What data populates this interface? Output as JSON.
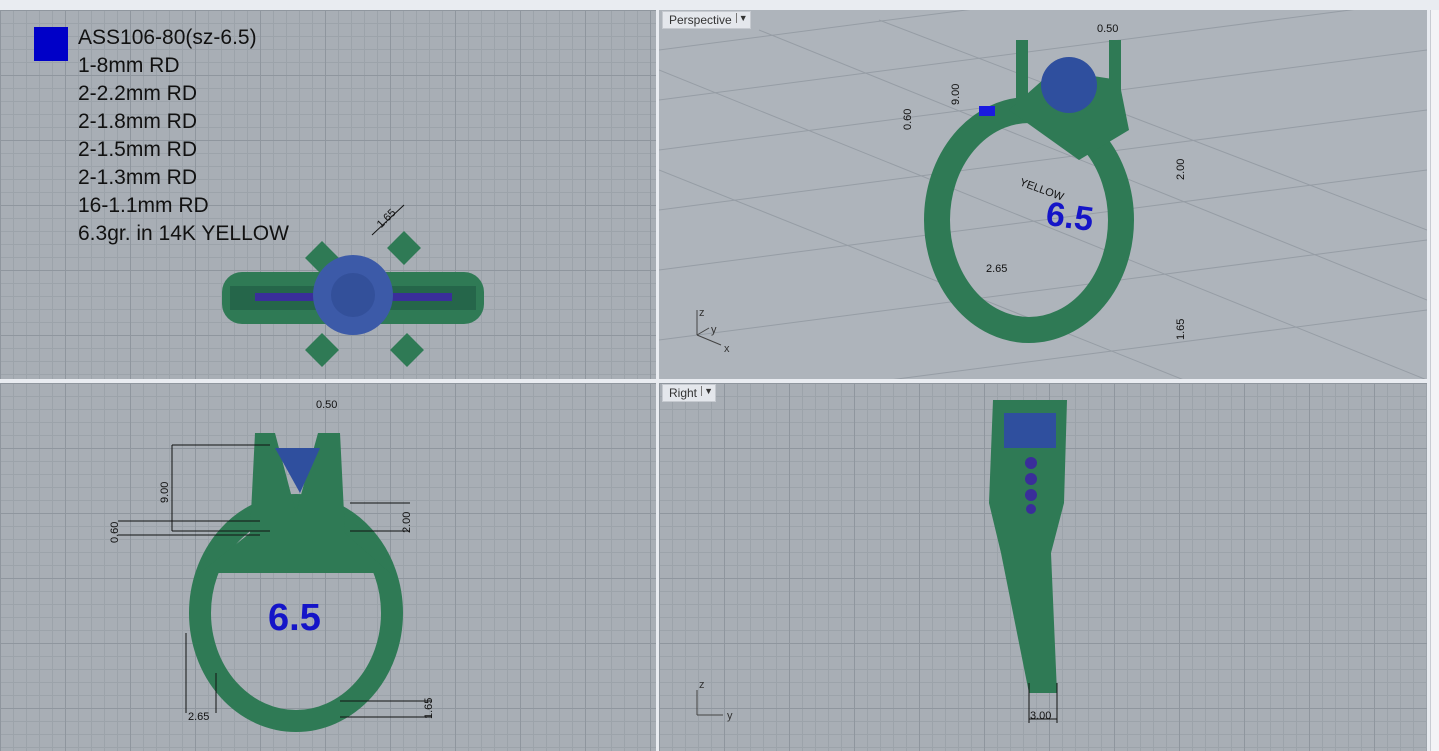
{
  "viewports": {
    "top": {
      "legend": [
        "ASS106-80(sz-6.5)",
        "1-8mm RD",
        "2-2.2mm RD",
        "2-1.8mm RD",
        "2-1.5mm RD",
        "2-1.3mm RD",
        "16-1.1mm RD",
        "6.3gr. in 14K YELLOW"
      ],
      "dim": "1.65"
    },
    "perspective": {
      "label": "Perspective",
      "size": "6.5",
      "dims": [
        "0.50",
        "9.00",
        "0.60",
        "2.00",
        "2.65",
        "1.65"
      ],
      "axes": [
        "z",
        "y",
        "x"
      ],
      "legend_partial": "YELLOW"
    },
    "front": {
      "size": "6.5",
      "dims": [
        "0.50",
        "9.00",
        "0.60",
        "2.00",
        "2.65",
        "1.65"
      ]
    },
    "right": {
      "label": "Right",
      "dims": [
        "3.00"
      ],
      "axes": [
        "z",
        "y"
      ]
    }
  },
  "colors": {
    "metal": "#2f7a55",
    "stone": "#2c4a9a",
    "legend_swatch": "#0000c8",
    "size_text": "#1414c8"
  }
}
